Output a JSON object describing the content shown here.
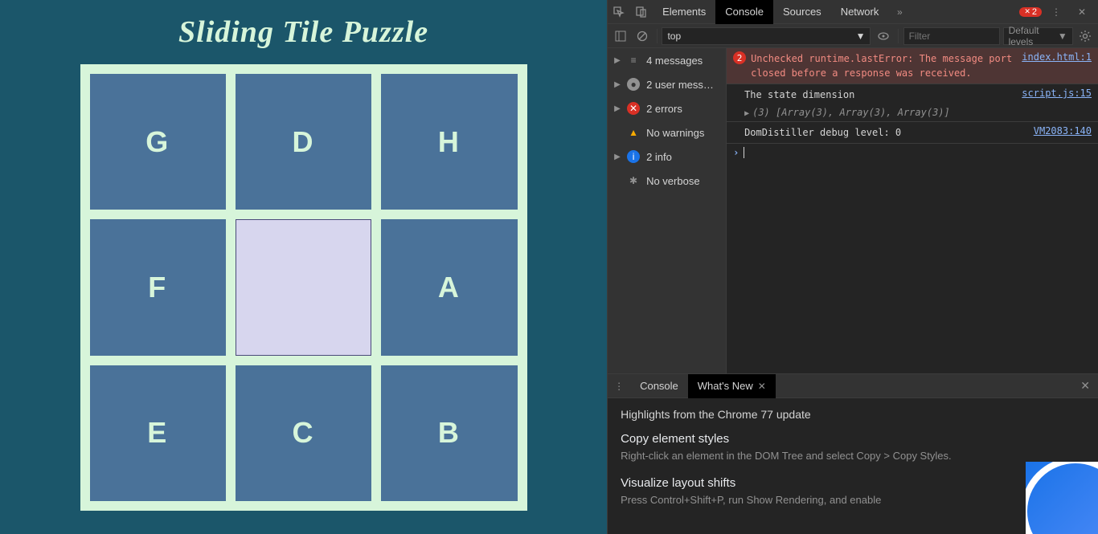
{
  "app": {
    "title": "Sliding Tile Puzzle",
    "tiles": [
      "G",
      "D",
      "H",
      "F",
      "",
      "A",
      "E",
      "C",
      "B"
    ]
  },
  "devtools": {
    "tabs": [
      "Elements",
      "Console",
      "Sources",
      "Network"
    ],
    "active_tab": "Console",
    "error_badge": "2",
    "context": "top",
    "filter_placeholder": "Filter",
    "levels_label": "Default levels",
    "sidebar": {
      "messages": "4 messages",
      "user": "2 user mess…",
      "errors": "2 errors",
      "warnings": "No warnings",
      "info": "2 info",
      "verbose": "No verbose"
    },
    "logs": {
      "err_count": "2",
      "err_text": "Unchecked runtime.lastError: The message port closed before a response was received.",
      "err_src": "index.html:1",
      "log1_text": "The state dimension",
      "log1_src": "script.js:15",
      "log1_expand": "(3) [Array(3), Array(3), Array(3)]",
      "log2_text": "DomDistiller debug level: 0",
      "log2_src": "VM2083:140"
    }
  },
  "drawer": {
    "tabs": [
      "Console",
      "What's New"
    ],
    "active_tab": "What's New",
    "headline": "Highlights from the Chrome 77 update",
    "sec1_title": "Copy element styles",
    "sec1_body": "Right-click an element in the DOM Tree and select Copy > Copy Styles.",
    "sec2_title": "Visualize layout shifts",
    "sec2_body": "Press Control+Shift+P, run Show Rendering, and enable"
  }
}
